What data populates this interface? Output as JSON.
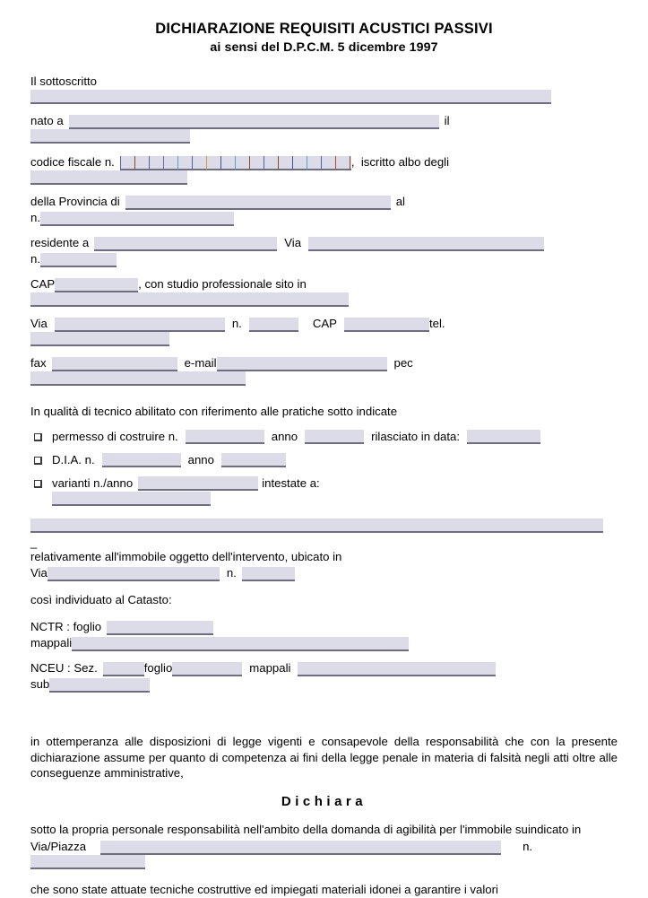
{
  "document": {
    "title_line1": "DICHIARAZIONE REQUISITI ACUSTICI PASSIVI",
    "title_line2": "ai sensi del D.P.C.M. 5 dicembre 1997"
  },
  "colors": {
    "field_background": "#dcdce8",
    "field_underline": "#6e6e80",
    "text": "#000000",
    "page_background": "#ffffff"
  },
  "labels": {
    "il_sottoscritto": "Il sottoscritto",
    "nato_a": "nato a",
    "il": "il",
    "codice_fiscale": "codice fiscale n.",
    "comma_iscritto": ",  iscritto albo degli",
    "della_provincia_di": "della Provincia di",
    "al": "al",
    "n_dot": "n.",
    "residente_a": "residente a",
    "via": "Via",
    "cap": "CAP",
    "con_studio": ", con studio professionale sito in",
    "n_space": "n.",
    "tel": "tel.",
    "fax": "fax",
    "email": "e-mail",
    "pec": "pec",
    "in_qualita": "In qualità di tecnico abilitato con riferimento alle pratiche sotto indicate",
    "permesso": "permesso di costruire n.",
    "anno": "anno",
    "rilasciato": "rilasciato in data:",
    "dia": "D.I.A. n.",
    "varianti": "varianti n./anno",
    "intestate_a": "intestate a:",
    "dash": "_",
    "relativamente": "relativamente all'immobile oggetto dell'intervento, ubicato in",
    "via_nospace": "Via",
    "cosi_individuato": "così individuato al Catasto:",
    "nctr_foglio": "NCTR : foglio",
    "mappali": "mappali",
    "nceu_sez": "NCEU : Sez.",
    "foglio": "foglio",
    "mappali2": "mappali",
    "sub": "sub",
    "via_piazza": "Via/Piazza",
    "n_final": "n."
  },
  "paragraphs": {
    "ottemperanza": "in ottemperanza alle disposizioni di legge vigenti e consapevole della responsabilità che con la presente dichiarazione assume per quanto di competenza ai fini della legge penale in materia di falsità negli atti oltre alle conseguenze amministrative,",
    "dichiara_heading": "Dichiara",
    "sotto_la_propria": "sotto la propria personale responsabilità nell'ambito della domanda di agibilità per l'immobile suindicato in",
    "che_sono_state": "che sono state attuate tecniche costruttive ed impiegati materiali idonei a garantire i valori"
  },
  "fields": {
    "sottoscritto": {
      "value": "",
      "placeholder": ""
    },
    "nato_a": {
      "value": "",
      "placeholder": ""
    },
    "il_data": {
      "value": "",
      "placeholder": ""
    },
    "codice_fiscale_cells": 16,
    "albo_degli": {
      "value": "",
      "placeholder": ""
    },
    "provincia": {
      "value": "",
      "placeholder": ""
    },
    "al_n": {
      "value": "",
      "placeholder": ""
    },
    "residente_a": {
      "value": "",
      "placeholder": ""
    },
    "residente_via": {
      "value": "",
      "placeholder": ""
    },
    "residente_n": {
      "value": "",
      "placeholder": ""
    },
    "cap_residenza": {
      "value": "",
      "placeholder": ""
    },
    "studio_sito_in": {
      "value": "",
      "placeholder": ""
    },
    "studio_via": {
      "value": "",
      "placeholder": ""
    },
    "studio_n": {
      "value": "",
      "placeholder": ""
    },
    "studio_cap": {
      "value": "",
      "placeholder": ""
    },
    "tel": {
      "value": "",
      "placeholder": ""
    },
    "fax": {
      "value": "",
      "placeholder": ""
    },
    "email": {
      "value": "",
      "placeholder": ""
    },
    "pec": {
      "value": "",
      "placeholder": ""
    },
    "permesso_n": {
      "value": "",
      "placeholder": ""
    },
    "permesso_anno": {
      "value": "",
      "placeholder": ""
    },
    "permesso_data": {
      "value": "",
      "placeholder": ""
    },
    "dia_n": {
      "value": "",
      "placeholder": ""
    },
    "dia_anno": {
      "value": "",
      "placeholder": ""
    },
    "varianti_n_anno": {
      "value": "",
      "placeholder": ""
    },
    "intestate_a": {
      "value": "",
      "placeholder": ""
    },
    "intestate_a_full": {
      "value": "",
      "placeholder": ""
    },
    "immobile_via": {
      "value": "",
      "placeholder": ""
    },
    "immobile_n": {
      "value": "",
      "placeholder": ""
    },
    "nctr_foglio": {
      "value": "",
      "placeholder": ""
    },
    "nctr_mappali": {
      "value": "",
      "placeholder": ""
    },
    "nceu_sez": {
      "value": "",
      "placeholder": ""
    },
    "nceu_foglio": {
      "value": "",
      "placeholder": ""
    },
    "nceu_mappali": {
      "value": "",
      "placeholder": ""
    },
    "nceu_sub": {
      "value": "",
      "placeholder": ""
    },
    "via_piazza": {
      "value": "",
      "placeholder": ""
    },
    "via_piazza_n": {
      "value": "",
      "placeholder": ""
    }
  },
  "checkboxes": [
    {
      "name": "permesso-di-costruire",
      "checked": false
    },
    {
      "name": "dia",
      "checked": false
    },
    {
      "name": "varianti",
      "checked": false
    }
  ]
}
